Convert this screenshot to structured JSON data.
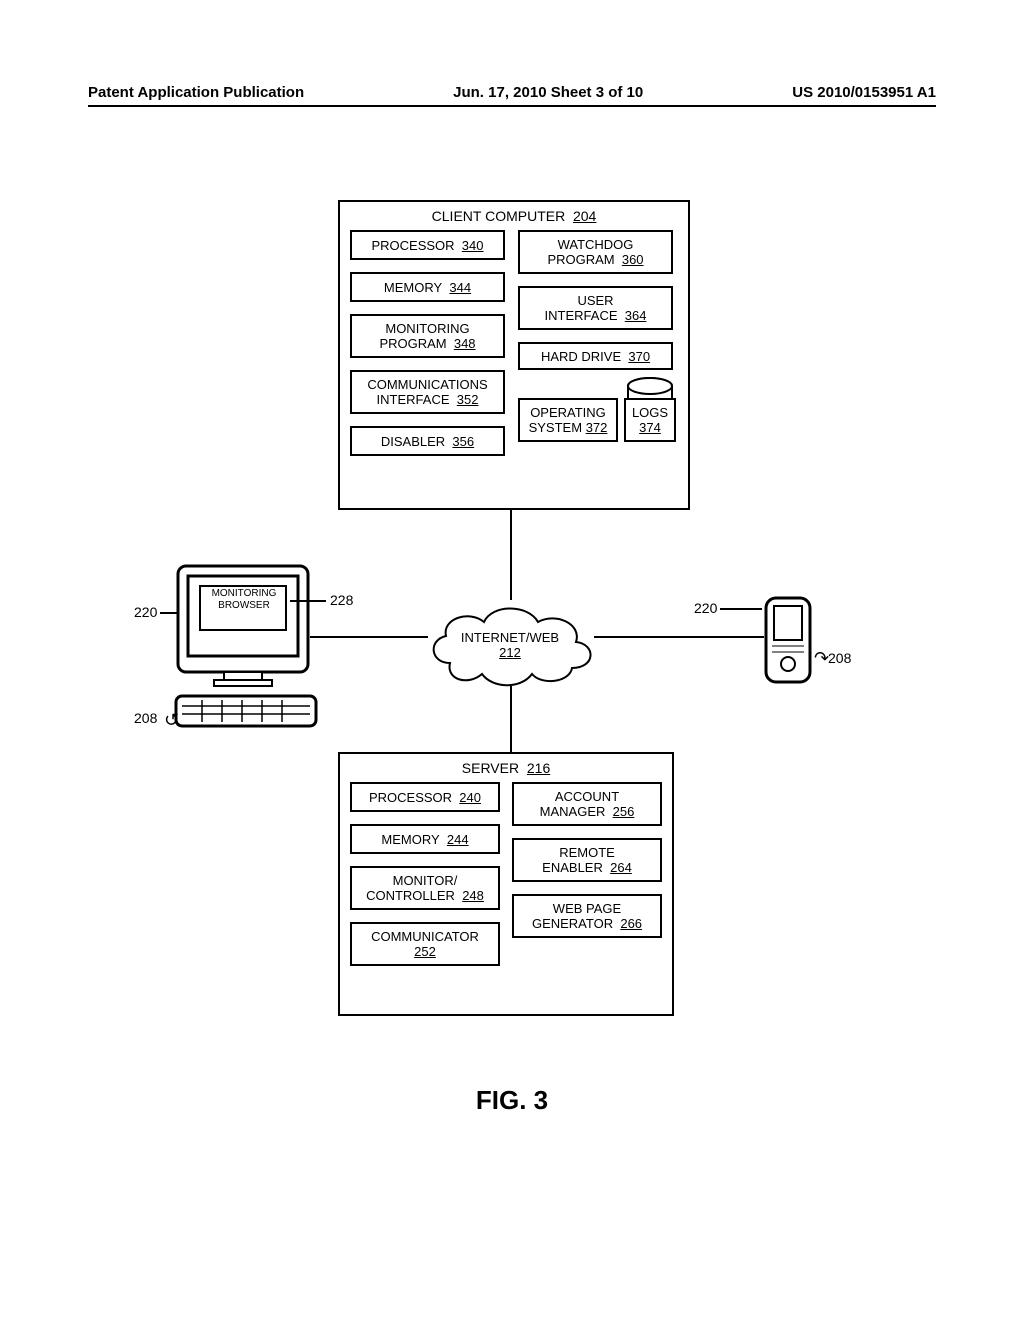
{
  "header": {
    "left": "Patent Application Publication",
    "center": "Jun. 17, 2010  Sheet 3 of 10",
    "right": "US 2010/0153951 A1"
  },
  "client": {
    "title": "CLIENT COMPUTER",
    "ref": "204",
    "processor": {
      "label": "PROCESSOR",
      "ref": "340"
    },
    "memory": {
      "label": "MEMORY",
      "ref": "344"
    },
    "monitoring_program": {
      "label1": "MONITORING",
      "label2": "PROGRAM",
      "ref": "348"
    },
    "comm_interface": {
      "label1": "COMMUNICATIONS",
      "label2": "INTERFACE",
      "ref": "352"
    },
    "disabler": {
      "label": "DISABLER",
      "ref": "356"
    },
    "watchdog": {
      "label1": "WATCHDOG",
      "label2": "PROGRAM",
      "ref": "360"
    },
    "user_interface": {
      "label1": "USER",
      "label2": "INTERFACE",
      "ref": "364"
    },
    "hard_drive": {
      "label": "HARD DRIVE",
      "ref": "370"
    },
    "os": {
      "label1": "OPERATING",
      "label2": "SYSTEM",
      "ref": "372"
    },
    "logs": {
      "label": "LOGS",
      "ref": "374"
    }
  },
  "monitoring_browser": {
    "label1": "MONITORING",
    "label2": "BROWSER"
  },
  "internet": {
    "label": "INTERNET/WEB",
    "ref": "212"
  },
  "server": {
    "title": "SERVER",
    "ref": "216",
    "processor": {
      "label": "PROCESSOR",
      "ref": "240"
    },
    "memory": {
      "label": "MEMORY",
      "ref": "244"
    },
    "monitor_controller": {
      "label1": "MONITOR/",
      "label2": "CONTROLLER",
      "ref": "248"
    },
    "communicator": {
      "label": "COMMUNICATOR",
      "ref": "252"
    },
    "account_manager": {
      "label1": "ACCOUNT",
      "label2": "MANAGER",
      "ref": "256"
    },
    "remote_enabler": {
      "label1": "REMOTE",
      "label2": "ENABLER",
      "ref": "264"
    },
    "web_page_generator": {
      "label1": "WEB PAGE",
      "label2": "GENERATOR",
      "ref": "266"
    }
  },
  "labels": {
    "l220a": "220",
    "l228": "228",
    "l208a": "208",
    "l220b": "220",
    "l208b": "208"
  },
  "figure": "FIG. 3"
}
